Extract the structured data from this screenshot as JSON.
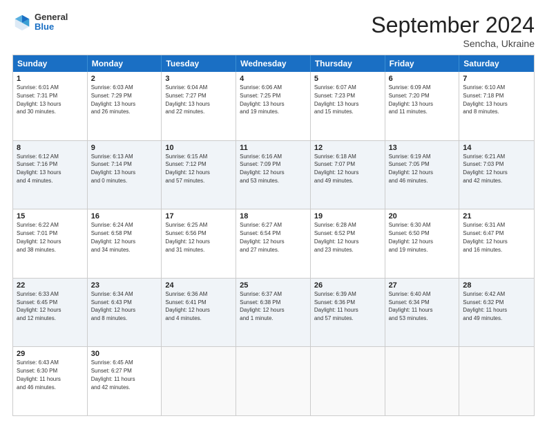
{
  "header": {
    "logo_general": "General",
    "logo_blue": "Blue",
    "month": "September 2024",
    "location": "Sencha, Ukraine"
  },
  "days_of_week": [
    "Sunday",
    "Monday",
    "Tuesday",
    "Wednesday",
    "Thursday",
    "Friday",
    "Saturday"
  ],
  "rows": [
    [
      {
        "day": "",
        "empty": true
      },
      {
        "day": "2",
        "line1": "Sunrise: 6:03 AM",
        "line2": "Sunset: 7:29 PM",
        "line3": "Daylight: 13 hours",
        "line4": "and 26 minutes."
      },
      {
        "day": "3",
        "line1": "Sunrise: 6:04 AM",
        "line2": "Sunset: 7:27 PM",
        "line3": "Daylight: 13 hours",
        "line4": "and 22 minutes."
      },
      {
        "day": "4",
        "line1": "Sunrise: 6:06 AM",
        "line2": "Sunset: 7:25 PM",
        "line3": "Daylight: 13 hours",
        "line4": "and 19 minutes."
      },
      {
        "day": "5",
        "line1": "Sunrise: 6:07 AM",
        "line2": "Sunset: 7:23 PM",
        "line3": "Daylight: 13 hours",
        "line4": "and 15 minutes."
      },
      {
        "day": "6",
        "line1": "Sunrise: 6:09 AM",
        "line2": "Sunset: 7:20 PM",
        "line3": "Daylight: 13 hours",
        "line4": "and 11 minutes."
      },
      {
        "day": "7",
        "line1": "Sunrise: 6:10 AM",
        "line2": "Sunset: 7:18 PM",
        "line3": "Daylight: 13 hours",
        "line4": "and 8 minutes."
      }
    ],
    [
      {
        "day": "1",
        "line1": "Sunrise: 6:01 AM",
        "line2": "Sunset: 7:31 PM",
        "line3": "Daylight: 13 hours",
        "line4": "and 30 minutes.",
        "shaded": true
      },
      {
        "day": "8",
        "line1": "Sunrise: 6:12 AM",
        "line2": "Sunset: 7:16 PM",
        "line3": "Daylight: 13 hours",
        "line4": "and 4 minutes.",
        "shaded": true
      },
      {
        "day": "9",
        "line1": "Sunrise: 6:13 AM",
        "line2": "Sunset: 7:14 PM",
        "line3": "Daylight: 13 hours",
        "line4": "and 0 minutes.",
        "shaded": true
      },
      {
        "day": "10",
        "line1": "Sunrise: 6:15 AM",
        "line2": "Sunset: 7:12 PM",
        "line3": "Daylight: 12 hours",
        "line4": "and 57 minutes.",
        "shaded": true
      },
      {
        "day": "11",
        "line1": "Sunrise: 6:16 AM",
        "line2": "Sunset: 7:09 PM",
        "line3": "Daylight: 12 hours",
        "line4": "and 53 minutes.",
        "shaded": true
      },
      {
        "day": "12",
        "line1": "Sunrise: 6:18 AM",
        "line2": "Sunset: 7:07 PM",
        "line3": "Daylight: 12 hours",
        "line4": "and 49 minutes.",
        "shaded": true
      },
      {
        "day": "13",
        "line1": "Sunrise: 6:19 AM",
        "line2": "Sunset: 7:05 PM",
        "line3": "Daylight: 12 hours",
        "line4": "and 46 minutes.",
        "shaded": true
      }
    ],
    [
      {
        "day": "14",
        "line1": "Sunrise: 6:21 AM",
        "line2": "Sunset: 7:03 PM",
        "line3": "Daylight: 12 hours",
        "line4": "and 42 minutes."
      },
      {
        "day": "15",
        "line1": "Sunrise: 6:22 AM",
        "line2": "Sunset: 7:01 PM",
        "line3": "Daylight: 12 hours",
        "line4": "and 38 minutes."
      },
      {
        "day": "16",
        "line1": "Sunrise: 6:24 AM",
        "line2": "Sunset: 6:58 PM",
        "line3": "Daylight: 12 hours",
        "line4": "and 34 minutes."
      },
      {
        "day": "17",
        "line1": "Sunrise: 6:25 AM",
        "line2": "Sunset: 6:56 PM",
        "line3": "Daylight: 12 hours",
        "line4": "and 31 minutes."
      },
      {
        "day": "18",
        "line1": "Sunrise: 6:27 AM",
        "line2": "Sunset: 6:54 PM",
        "line3": "Daylight: 12 hours",
        "line4": "and 27 minutes."
      },
      {
        "day": "19",
        "line1": "Sunrise: 6:28 AM",
        "line2": "Sunset: 6:52 PM",
        "line3": "Daylight: 12 hours",
        "line4": "and 23 minutes."
      },
      {
        "day": "20",
        "line1": "Sunrise: 6:30 AM",
        "line2": "Sunset: 6:50 PM",
        "line3": "Daylight: 12 hours",
        "line4": "and 19 minutes."
      }
    ],
    [
      {
        "day": "21",
        "line1": "Sunrise: 6:31 AM",
        "line2": "Sunset: 6:47 PM",
        "line3": "Daylight: 12 hours",
        "line4": "and 16 minutes.",
        "shaded": true
      },
      {
        "day": "22",
        "line1": "Sunrise: 6:33 AM",
        "line2": "Sunset: 6:45 PM",
        "line3": "Daylight: 12 hours",
        "line4": "and 12 minutes.",
        "shaded": true
      },
      {
        "day": "23",
        "line1": "Sunrise: 6:34 AM",
        "line2": "Sunset: 6:43 PM",
        "line3": "Daylight: 12 hours",
        "line4": "and 8 minutes.",
        "shaded": true
      },
      {
        "day": "24",
        "line1": "Sunrise: 6:36 AM",
        "line2": "Sunset: 6:41 PM",
        "line3": "Daylight: 12 hours",
        "line4": "and 4 minutes.",
        "shaded": true
      },
      {
        "day": "25",
        "line1": "Sunrise: 6:37 AM",
        "line2": "Sunset: 6:38 PM",
        "line3": "Daylight: 12 hours",
        "line4": "and 1 minute.",
        "shaded": true
      },
      {
        "day": "26",
        "line1": "Sunrise: 6:39 AM",
        "line2": "Sunset: 6:36 PM",
        "line3": "Daylight: 11 hours",
        "line4": "and 57 minutes.",
        "shaded": true
      },
      {
        "day": "27",
        "line1": "Sunrise: 6:40 AM",
        "line2": "Sunset: 6:34 PM",
        "line3": "Daylight: 11 hours",
        "line4": "and 53 minutes.",
        "shaded": true
      }
    ],
    [
      {
        "day": "28",
        "line1": "Sunrise: 6:42 AM",
        "line2": "Sunset: 6:32 PM",
        "line3": "Daylight: 11 hours",
        "line4": "and 49 minutes."
      },
      {
        "day": "29",
        "line1": "Sunrise: 6:43 AM",
        "line2": "Sunset: 6:30 PM",
        "line3": "Daylight: 11 hours",
        "line4": "and 46 minutes."
      },
      {
        "day": "30",
        "line1": "Sunrise: 6:45 AM",
        "line2": "Sunset: 6:27 PM",
        "line3": "Daylight: 11 hours",
        "line4": "and 42 minutes."
      },
      {
        "day": "",
        "empty": true
      },
      {
        "day": "",
        "empty": true
      },
      {
        "day": "",
        "empty": true
      },
      {
        "day": "",
        "empty": true
      }
    ]
  ]
}
